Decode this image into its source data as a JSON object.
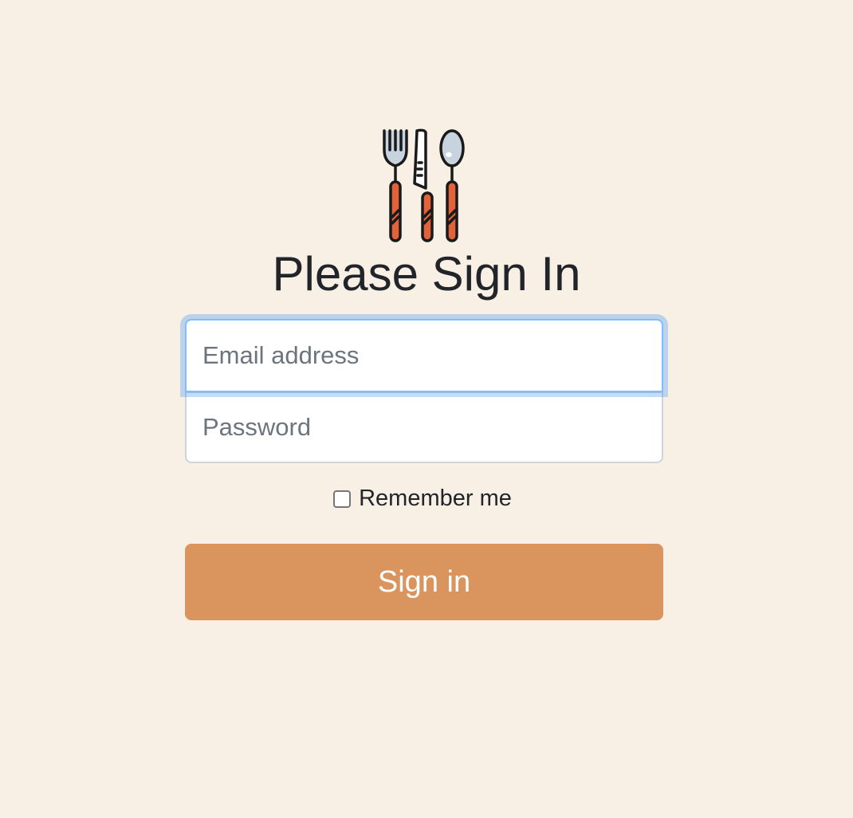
{
  "page": {
    "title": "Please Sign In"
  },
  "logo": {
    "icon": "utensils-icon"
  },
  "form": {
    "email_placeholder": "Email address",
    "email_value": "",
    "password_placeholder": "Password",
    "password_value": "",
    "remember_label": "Remember me",
    "remember_checked": false,
    "signin_label": "Sign in"
  },
  "colors": {
    "background": "#f8f0e5",
    "button": "#da955f",
    "focus_border": "#80bdff",
    "handle": "#e2623a"
  }
}
